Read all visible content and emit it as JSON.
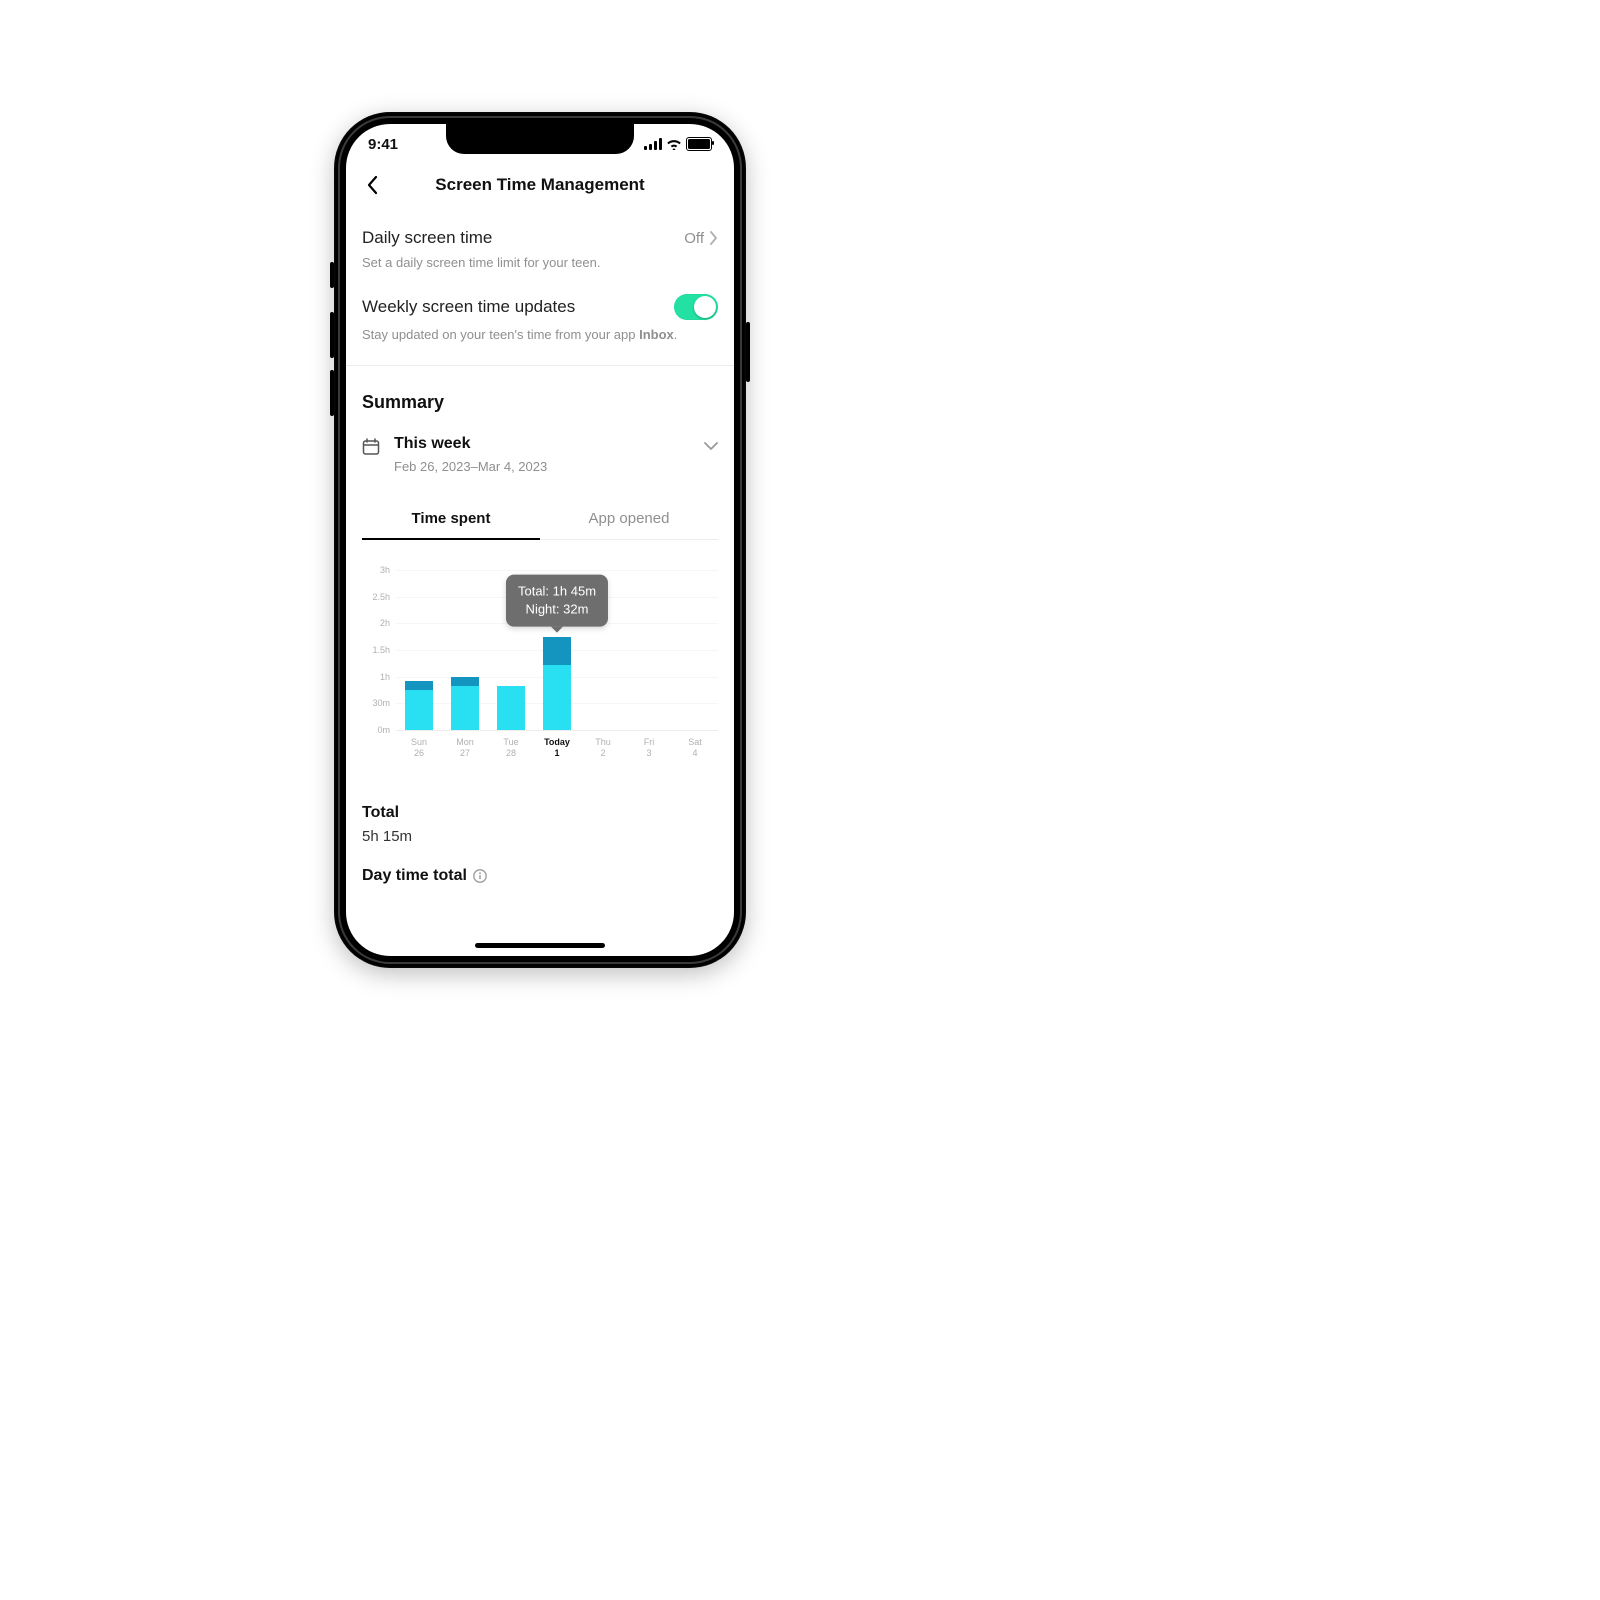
{
  "statusbar": {
    "time": "9:41"
  },
  "header": {
    "title": "Screen Time Management"
  },
  "daily": {
    "title": "Daily screen time",
    "value": "Off",
    "subtitle": "Set a daily screen time limit for your teen."
  },
  "weekly": {
    "title": "Weekly screen time updates",
    "subtitle_a": "Stay updated on your teen's time from your app ",
    "subtitle_b": "Inbox",
    "subtitle_c": "."
  },
  "summary": {
    "heading": "Summary",
    "period_label": "This week",
    "period_range": "Feb 26, 2023–Mar 4, 2023"
  },
  "tabs": {
    "time_spent": "Time spent",
    "app_opened": "App opened"
  },
  "tooltip": {
    "line1": "Total: 1h 45m",
    "line2": "Night: 32m"
  },
  "totals": {
    "total_label": "Total",
    "total_value": "5h 15m",
    "day_label": "Day time total"
  },
  "chart_data": {
    "type": "bar",
    "title": "Time spent",
    "ylabel": "hours",
    "ylim": [
      0,
      3
    ],
    "y_ticks": [
      "0m",
      "30m",
      "1h",
      "1.5h",
      "2h",
      "2.5h",
      "3h"
    ],
    "categories": [
      {
        "day": "Sun",
        "date": "26"
      },
      {
        "day": "Mon",
        "date": "27"
      },
      {
        "day": "Tue",
        "date": "28"
      },
      {
        "day": "Today",
        "date": "1",
        "active": true
      },
      {
        "day": "Thu",
        "date": "2"
      },
      {
        "day": "Fri",
        "date": "3"
      },
      {
        "day": "Sat",
        "date": "4"
      }
    ],
    "series": [
      {
        "name": "Total",
        "unit": "minutes",
        "values": [
          55,
          60,
          50,
          105,
          0,
          0,
          0
        ]
      },
      {
        "name": "Night",
        "unit": "minutes",
        "values": [
          10,
          10,
          0,
          32,
          0,
          0,
          0
        ]
      }
    ],
    "tooltip_index": 3
  }
}
